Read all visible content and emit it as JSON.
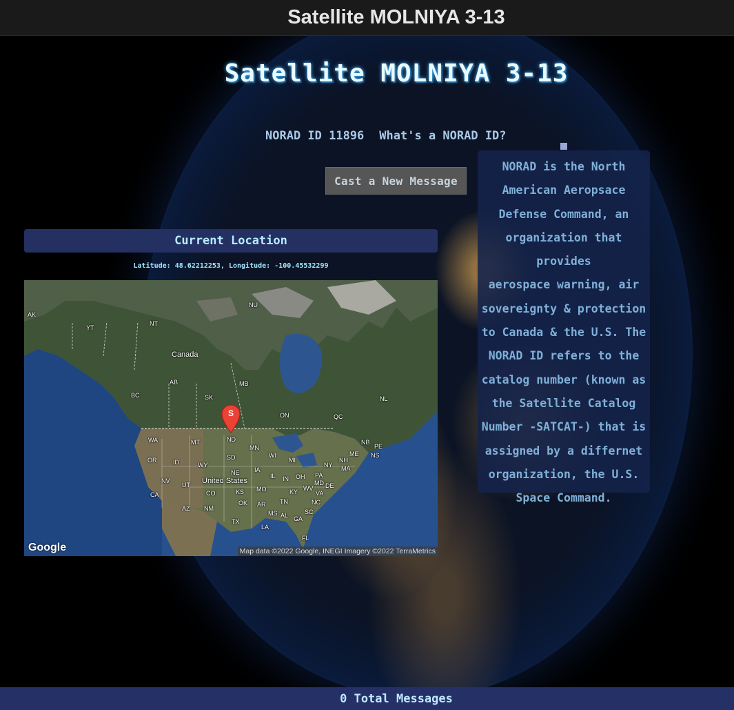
{
  "header": {
    "title": "Satellite MOLNIYA 3-13"
  },
  "hero": {
    "title": "Satellite MOLNIYA 3-13"
  },
  "norad": {
    "id_text": "NORAD ID 11896",
    "help_link": "What's a NORAD ID?"
  },
  "actions": {
    "cast_message": "Cast a New Message"
  },
  "info_box": {
    "lines": [
      "NORAD is the North",
      "American Aeropsace",
      "Defense Command, an",
      "organization that provides",
      "aerospace warning, air",
      "sovereignty & protection",
      "to Canada & the U.S. The",
      "NORAD ID refers to the",
      "catalog number (known as",
      "the Satellite Catalog",
      "Number -SATCAT-) that is",
      "assigned by a differnet",
      "organization, the U.S.",
      "Space Command."
    ]
  },
  "location": {
    "header": "Current Location",
    "coords": "Latitude: 48.62212253, Longitude: -100.45532299"
  },
  "map": {
    "marker_label": "S",
    "logo": "Google",
    "attribution": "Map data ©2022 Google, INEGI Imagery ©2022 TerraMetrics",
    "labels": {
      "ak": "AK",
      "yt": "YT",
      "nt": "NT",
      "nu": "NU",
      "canada": "Canada",
      "bc": "BC",
      "ab": "AB",
      "sk": "SK",
      "mb": "MB",
      "on": "ON",
      "qc": "QC",
      "nl": "NL",
      "nb": "NB",
      "pe": "PE",
      "ns": "NS",
      "wa": "WA",
      "mt": "MT",
      "nd": "ND",
      "mn": "MN",
      "or": "OR",
      "id": "ID",
      "wy": "WY",
      "sd": "SD",
      "wi": "WI",
      "mi": "MI",
      "ny": "NY",
      "nh": "NH",
      "me": "ME",
      "ma": "MA",
      "nv": "NV",
      "ut": "UT",
      "us": "United States",
      "ne": "NE",
      "ia": "IA",
      "il": "IL",
      "in": "IN",
      "oh": "OH",
      "pa": "PA",
      "md": "MD",
      "de": "DE",
      "ca": "CA",
      "co": "CO",
      "ks": "KS",
      "mo": "MO",
      "ky": "KY",
      "wv": "WV",
      "va": "VA",
      "az": "AZ",
      "nm": "NM",
      "ok": "OK",
      "ar": "AR",
      "tn": "TN",
      "nc": "NC",
      "tx": "TX",
      "ms": "MS",
      "al": "AL",
      "ga": "GA",
      "sc": "SC",
      "la": "LA",
      "fl": "FL"
    }
  },
  "footer": {
    "total_messages": "0 Total Messages"
  }
}
